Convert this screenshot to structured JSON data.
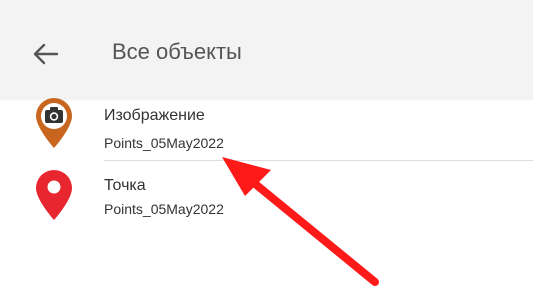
{
  "header": {
    "title": "Все объекты",
    "back_icon": "arrow-left-icon"
  },
  "list": {
    "items": [
      {
        "title": "Изображение",
        "subtitle": "Points_05May2022",
        "icon": "camera-pin-icon",
        "icon_color": "#c8651e"
      },
      {
        "title": "Точка",
        "subtitle": "Points_05May2022",
        "icon": "map-pin-icon",
        "icon_color": "#e8262f"
      }
    ]
  },
  "annotation": {
    "arrow_color": "#ff1a1a"
  }
}
